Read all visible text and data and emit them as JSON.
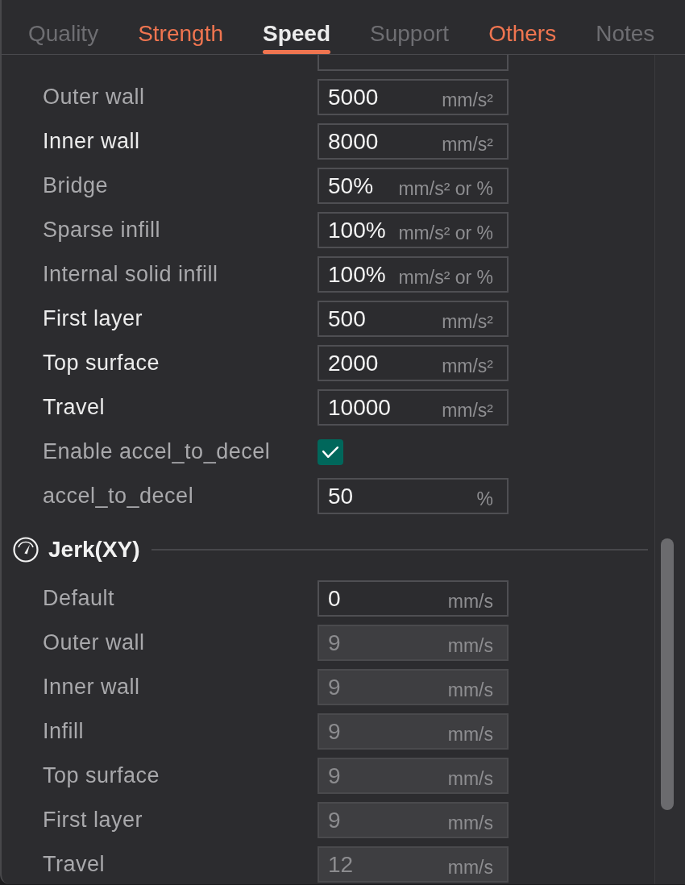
{
  "tabs": [
    {
      "label": "Quality",
      "selected": false,
      "color": "#6e6e72"
    },
    {
      "label": "Strength",
      "selected": false,
      "color": "#f07550"
    },
    {
      "label": "Speed",
      "selected": true,
      "color": "#ececec"
    },
    {
      "label": "Support",
      "selected": false,
      "color": "#6e6e72"
    },
    {
      "label": "Others",
      "selected": false,
      "color": "#f07550"
    },
    {
      "label": "Notes",
      "selected": false,
      "color": "#6e6e72"
    }
  ],
  "sections": [
    {
      "rows": [
        {
          "kind": "number",
          "label": "Outer wall",
          "modified": false,
          "value": "5000",
          "unit": "mm/s²",
          "disabled": false
        },
        {
          "kind": "number",
          "label": "Inner wall",
          "modified": true,
          "value": "8000",
          "unit": "mm/s²",
          "disabled": false
        },
        {
          "kind": "number",
          "label": "Bridge",
          "modified": false,
          "value": "50%",
          "unit": "mm/s² or %",
          "disabled": false
        },
        {
          "kind": "number",
          "label": "Sparse infill",
          "modified": false,
          "value": "100%",
          "unit": "mm/s² or %",
          "disabled": false
        },
        {
          "kind": "number",
          "label": "Internal solid infill",
          "modified": false,
          "value": "100%",
          "unit": "mm/s² or %",
          "disabled": false
        },
        {
          "kind": "number",
          "label": "First layer",
          "modified": true,
          "value": "500",
          "unit": "mm/s²",
          "disabled": false
        },
        {
          "kind": "number",
          "label": "Top surface",
          "modified": true,
          "value": "2000",
          "unit": "mm/s²",
          "disabled": false
        },
        {
          "kind": "number",
          "label": "Travel",
          "modified": true,
          "value": "10000",
          "unit": "mm/s²",
          "disabled": false
        },
        {
          "kind": "checkbox",
          "label": "Enable accel_to_decel",
          "modified": false,
          "checked": true
        },
        {
          "kind": "number",
          "label": "accel_to_decel",
          "modified": false,
          "value": "50",
          "unit": "%",
          "disabled": false
        }
      ]
    },
    {
      "title": "Jerk(XY)",
      "rows": [
        {
          "kind": "number",
          "label": "Default",
          "modified": false,
          "value": "0",
          "unit": "mm/s",
          "disabled": false
        },
        {
          "kind": "number",
          "label": "Outer wall",
          "modified": false,
          "value": "9",
          "unit": "mm/s",
          "disabled": true
        },
        {
          "kind": "number",
          "label": "Inner wall",
          "modified": false,
          "value": "9",
          "unit": "mm/s",
          "disabled": true
        },
        {
          "kind": "number",
          "label": "Infill",
          "modified": false,
          "value": "9",
          "unit": "mm/s",
          "disabled": true
        },
        {
          "kind": "number",
          "label": "Top surface",
          "modified": false,
          "value": "9",
          "unit": "mm/s",
          "disabled": true
        },
        {
          "kind": "number",
          "label": "First layer",
          "modified": false,
          "value": "9",
          "unit": "mm/s",
          "disabled": true
        },
        {
          "kind": "number",
          "label": "Travel",
          "modified": false,
          "value": "12",
          "unit": "mm/s",
          "disabled": true
        }
      ]
    }
  ]
}
